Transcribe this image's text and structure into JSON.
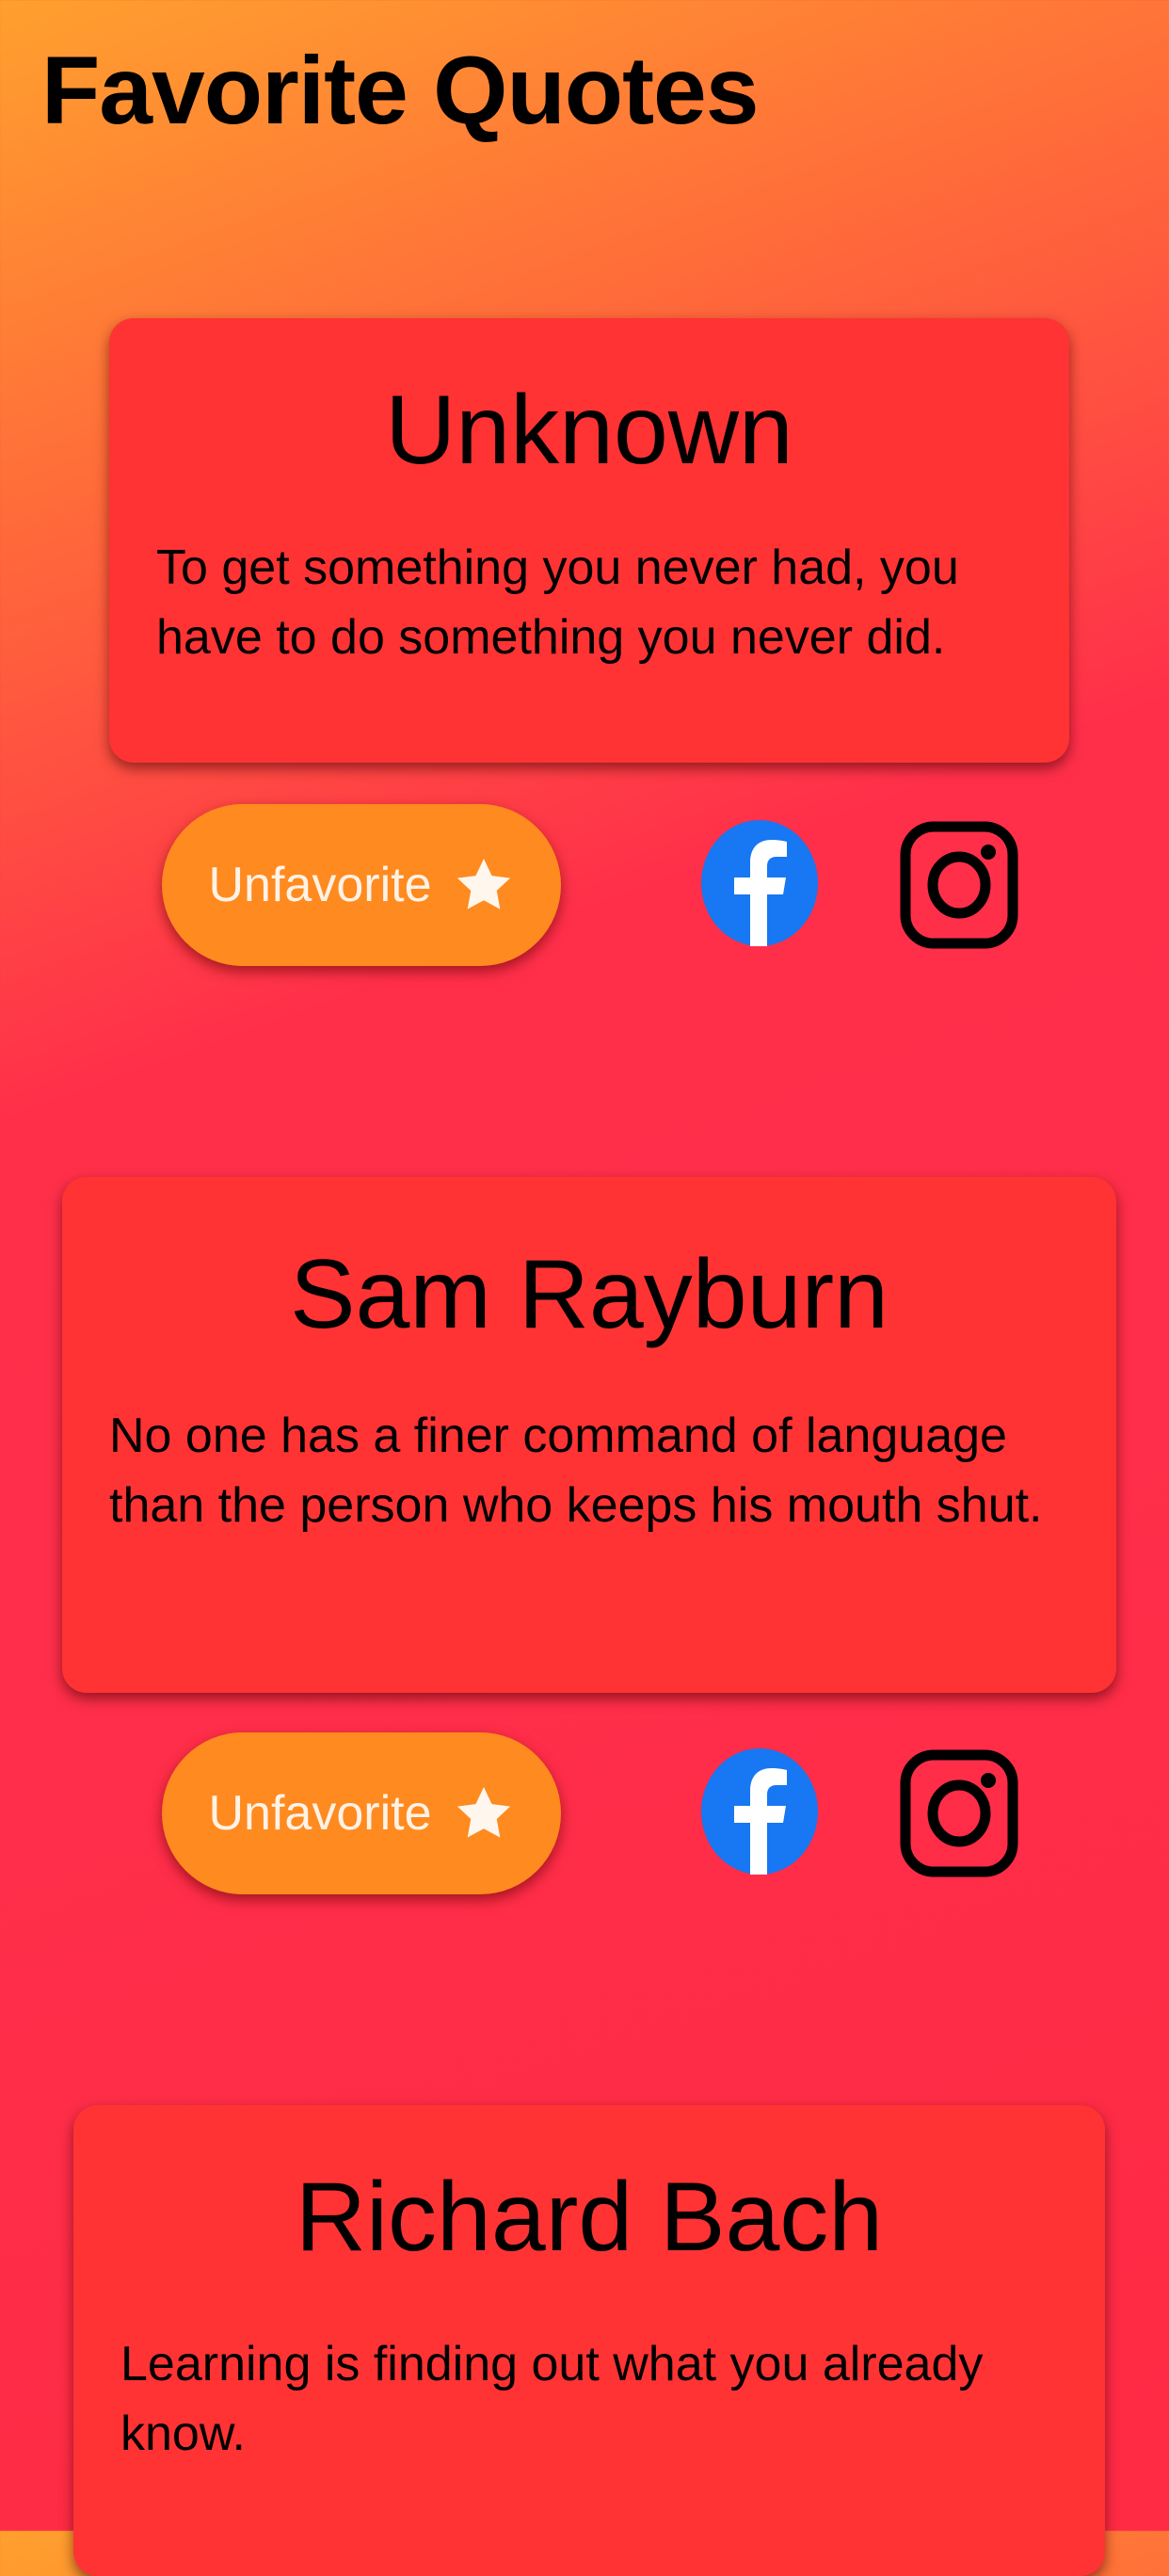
{
  "header": {
    "title": "Favorite Quotes"
  },
  "quotes": [
    {
      "author": "Unknown",
      "text": "To get something you never had, you have to do something you never did.",
      "favorite_label": "Unfavorite"
    },
    {
      "author": "Sam Rayburn",
      "text": "No one has a finer command of language than the person who keeps his mouth shut.",
      "favorite_label": "Unfavorite"
    },
    {
      "author": "Richard Bach",
      "text": "Learning is finding out what you already know."
    }
  ],
  "icons": {
    "favorite": "star-icon",
    "share_facebook": "facebook-icon",
    "share_instagram": "instagram-icon"
  },
  "colors": {
    "card": "#ff3333",
    "button": "#ff8a1f",
    "facebook": "#1877f2"
  }
}
